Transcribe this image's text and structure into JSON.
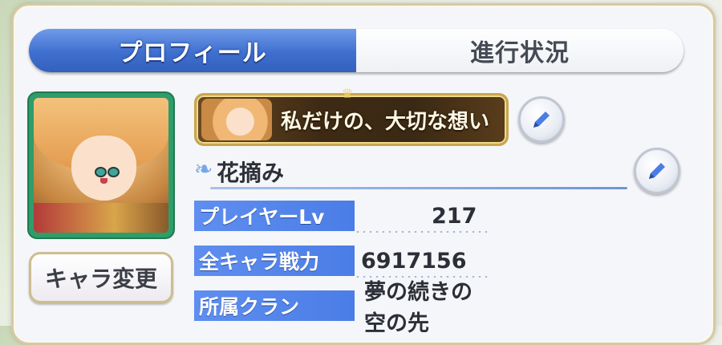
{
  "tabs": [
    {
      "label": "プロフィール",
      "active": true
    },
    {
      "label": "進行状況",
      "active": false
    }
  ],
  "avatar": {
    "icon": "character-portrait"
  },
  "change_character_button": {
    "label": "キャラ変更"
  },
  "title_banner": {
    "text": "私だけの、大切な想い"
  },
  "player": {
    "name": "花摘み"
  },
  "info": [
    {
      "label": "プレイヤーLv",
      "value": "217"
    },
    {
      "label": "全キャラ戦力",
      "value": "6917156"
    },
    {
      "label": "所属クラン",
      "value": "夢の続きの空の先"
    }
  ],
  "colors": {
    "accent_blue": "#4a7de6",
    "avatar_frame": "#2f9c6a",
    "gold_frame": "#c9a64b"
  }
}
